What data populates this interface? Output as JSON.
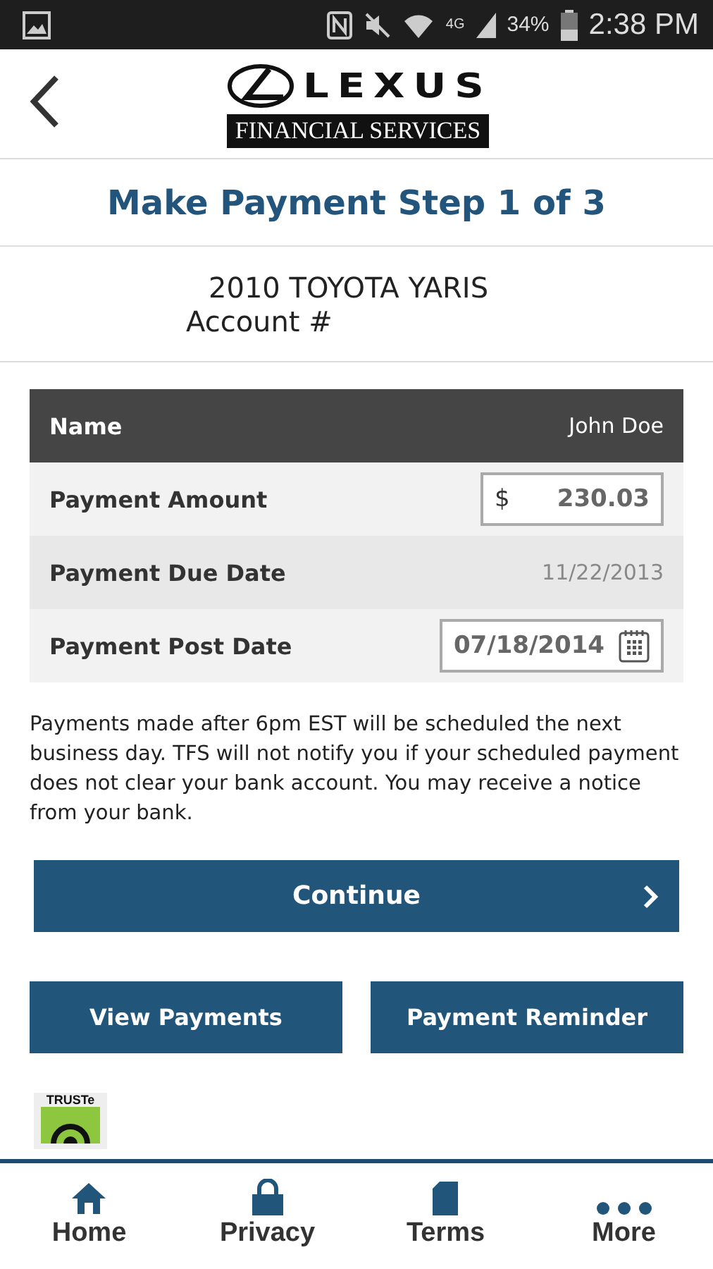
{
  "status_bar": {
    "network": "4G",
    "battery": "34%",
    "time": "2:38 PM"
  },
  "header": {
    "brand": "LEXUS",
    "subtitle": "FINANCIAL SERVICES"
  },
  "title": "Make Payment Step 1 of 3",
  "vehicle": {
    "name": "2010 TOYOTA YARIS",
    "account": "Account #"
  },
  "rows": [
    {
      "kind": "header",
      "label": "Name",
      "value": "John Doe"
    },
    {
      "kind": "amount",
      "label": "Payment Amount",
      "currency": "$",
      "value": "230.03"
    },
    {
      "kind": "text",
      "label": "Payment Due Date",
      "value": "11/22/2013"
    },
    {
      "kind": "date",
      "label": "Payment Post Date",
      "value": "07/18/2014"
    }
  ],
  "notice": "Payments made after 6pm EST will be scheduled the next business day. TFS will not notify you if your scheduled payment does not clear your bank account. You may receive a notice from your bank.",
  "continue_button": "Continue",
  "buttons": [
    "View Payments",
    "Payment Reminder"
  ],
  "badge": "TRUSTe",
  "nav": [
    {
      "kind": "home",
      "label": "Home"
    },
    {
      "kind": "lock",
      "label": "Privacy"
    },
    {
      "kind": "doc",
      "label": "Terms"
    },
    {
      "kind": "more",
      "label": "More"
    }
  ]
}
